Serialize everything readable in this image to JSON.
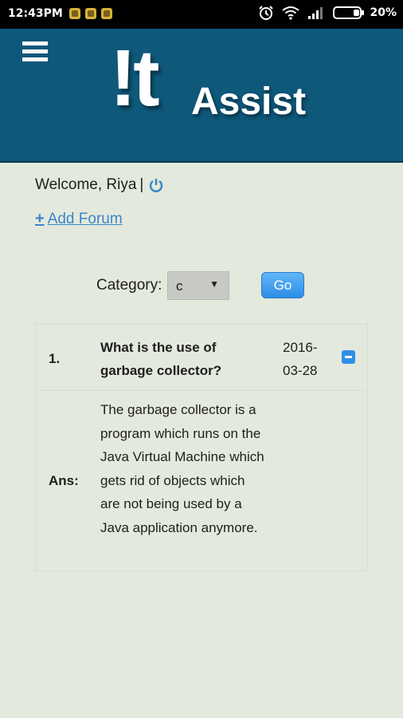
{
  "status_bar": {
    "time": "12:43PM",
    "notification_icons": [
      "notification-icon",
      "notification-icon",
      "notification-icon"
    ],
    "battery_percent": "20%",
    "icons": [
      "alarm-icon",
      "wifi-icon",
      "signal-icon",
      "battery-icon"
    ]
  },
  "header": {
    "logo_mark": "!t",
    "logo_word": "Assist",
    "background_color": "#0e587a"
  },
  "welcome": {
    "text": "Welcome, Riya",
    "separator": "|"
  },
  "add_forum": {
    "icon": "+",
    "label": "Add Forum"
  },
  "filter": {
    "category_label": "Category:",
    "selected_category": "c",
    "go_label": "Go"
  },
  "faq_items": [
    {
      "number": "1.",
      "question": "What is the use of garbage collector?",
      "date": "2016-03-28",
      "answer_label": "Ans:",
      "answer": "The garbage collector is a program which runs on the Java Virtual Machine which gets rid of objects which are not being used by a Java application anymore."
    }
  ],
  "colors": {
    "accent": "#2f8fe6",
    "link": "#3a86c8",
    "page_background": "#e4e9dd"
  }
}
